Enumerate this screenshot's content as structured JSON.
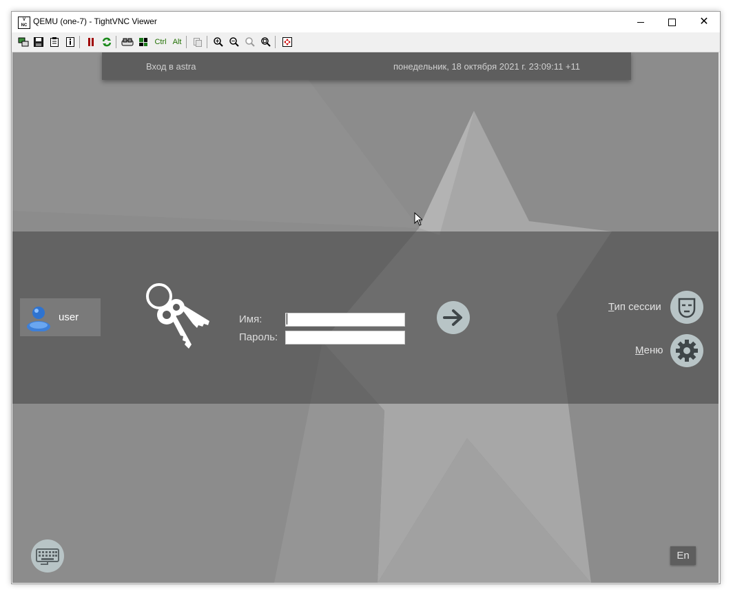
{
  "window": {
    "title": "QEMU (one-7) - TightVNC Viewer",
    "icon_text_top": "V",
    "icon_text_bottom": "NC",
    "minimize_icon": "minimize-icon",
    "maximize_icon": "maximize-icon",
    "close_glyph": "✕"
  },
  "toolbar": {
    "ctrl_label": "Ctrl",
    "alt_label": "Alt",
    "items": [
      "new-connection-icon",
      "save-icon",
      "options-icon",
      "info-icon",
      "pause-icon",
      "refresh-icon",
      "ctrl-alt-del-icon",
      "ctrl-esc-icon",
      "ctrl-key",
      "alt-key",
      "clipboard-icon",
      "zoom-in-icon",
      "zoom-out-icon",
      "zoom-100-icon",
      "zoom-auto-icon",
      "fullscreen-icon"
    ]
  },
  "greeter": {
    "header_left": "Вход в astra",
    "header_right": "понедельник, 18 октября 2021 г. 23:09:11 +11",
    "user_name": "user",
    "login_label": "Имя:",
    "password_label": "Пароль:",
    "login_value": "",
    "password_value": "",
    "session_label_first": "Т",
    "session_label_rest": "ип сессии",
    "menu_label_first": "М",
    "menu_label_rest": "еню",
    "lang_label": "En"
  },
  "colors": {
    "screen_bg": "#8e8e8e",
    "band": "#4a4a4a",
    "button_circle": "#b8c4c6",
    "header_bar": "#5e5e5e"
  }
}
